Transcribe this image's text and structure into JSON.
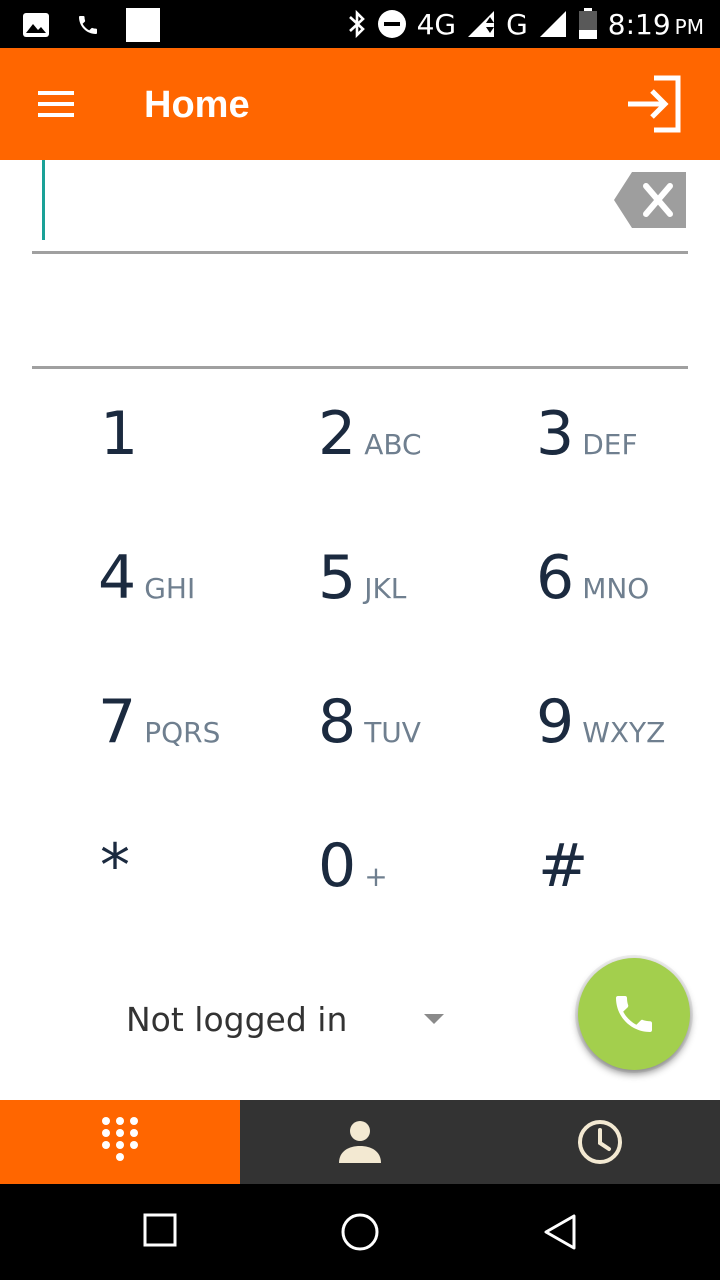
{
  "status_bar": {
    "network_4g": "4G",
    "network_g": "G",
    "time": "8:19",
    "ampm": "PM"
  },
  "app_bar": {
    "title": "Home",
    "menu_icon": "hamburger-menu-icon",
    "login_icon": "login-icon"
  },
  "dialer": {
    "number_value": "",
    "number_placeholder": "",
    "keys": [
      {
        "digit": "1",
        "letters": ""
      },
      {
        "digit": "2",
        "letters": "ABC"
      },
      {
        "digit": "3",
        "letters": "DEF"
      },
      {
        "digit": "4",
        "letters": "GHI"
      },
      {
        "digit": "5",
        "letters": "JKL"
      },
      {
        "digit": "6",
        "letters": "MNO"
      },
      {
        "digit": "7",
        "letters": "PQRS"
      },
      {
        "digit": "8",
        "letters": "TUV"
      },
      {
        "digit": "9",
        "letters": "WXYZ"
      },
      {
        "digit": "*",
        "letters": ""
      },
      {
        "digit": "0",
        "letters": "+"
      },
      {
        "digit": "#",
        "letters": ""
      }
    ]
  },
  "account": {
    "label": "Not logged in"
  },
  "tabs": [
    {
      "icon": "dialpad-icon",
      "active": true
    },
    {
      "icon": "contacts-icon",
      "active": false
    },
    {
      "icon": "history-clock-icon",
      "active": false
    }
  ],
  "colors": {
    "accent": "#ff6600",
    "call_button": "#a3cf4d",
    "caret": "#1aa197",
    "digit": "#1b2a3f",
    "tab_bar": "#333333",
    "tab_icon": "#f3e9d2"
  }
}
